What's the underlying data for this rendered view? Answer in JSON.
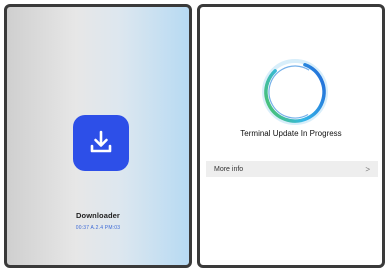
{
  "left_panel": {
    "app_icon": "download-icon",
    "app_name": "Downloader",
    "app_version": "00:37 A.2.4 PM:03",
    "icon_color": "#2d4fe8"
  },
  "right_panel": {
    "spinner": "progress-ring",
    "title": "Terminal Update In Progress",
    "info_row": {
      "label": "More info",
      "chevron": ">"
    },
    "ring_colors": [
      "#1f5fd6",
      "#35b7e8",
      "#4fc44d"
    ]
  }
}
